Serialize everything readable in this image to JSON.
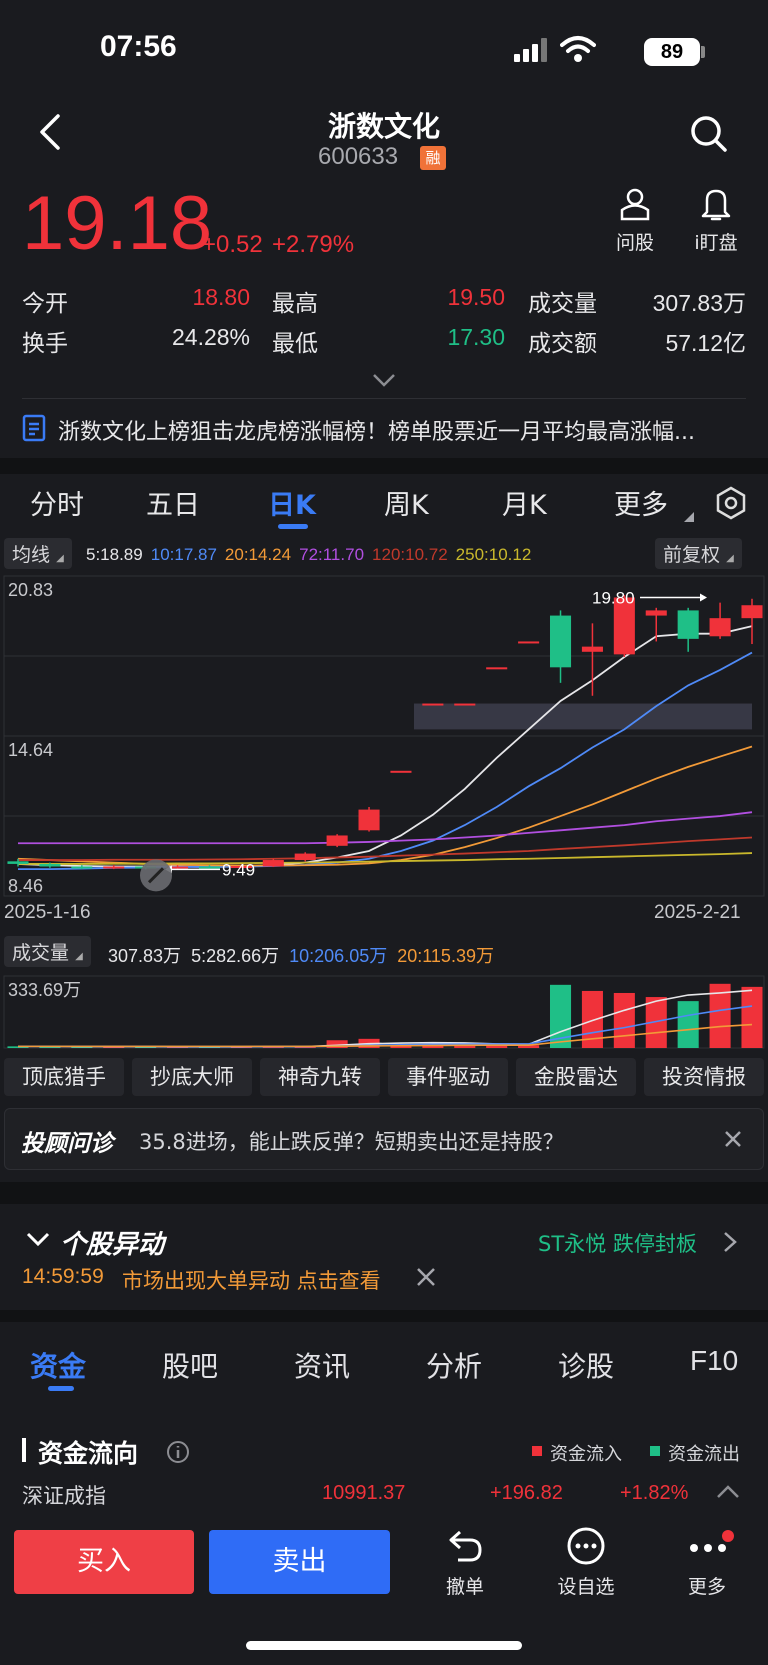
{
  "status_bar": {
    "time": "07:56",
    "battery": "89"
  },
  "header": {
    "title": "浙数文化",
    "code": "600633",
    "rong_badge": "融"
  },
  "quote": {
    "price": "19.18",
    "change": "+0.52",
    "change_pct": "+2.79%",
    "ask_label": "问股",
    "watch_label": "i盯盘",
    "open_label": "今开",
    "open": "18.80",
    "high_label": "最高",
    "high": "19.50",
    "volume_label": "成交量",
    "volume": "307.83万",
    "turnover_label": "换手",
    "turnover": "24.28%",
    "low_label": "最低",
    "low": "17.30",
    "amount_label": "成交额",
    "amount": "57.12亿"
  },
  "news": {
    "text": "浙数文化上榜狙击龙虎榜涨幅榜！榜单股票近一月平均最高涨幅..."
  },
  "chart_tabs": [
    "分时",
    "五日",
    "日K",
    "周K",
    "月K",
    "更多"
  ],
  "active_chart_tab": "日K",
  "ma_bar": {
    "label": "均线",
    "items": [
      {
        "text": "5:18.89",
        "color": "#e6e6e9"
      },
      {
        "text": "10:17.87",
        "color": "#4f8af7"
      },
      {
        "text": "20:14.24",
        "color": "#f29a38"
      },
      {
        "text": "72:11.70",
        "color": "#b14fe0"
      },
      {
        "text": "120:10.72",
        "color": "#c0392b"
      },
      {
        "text": "250:10.12",
        "color": "#c9b82c"
      }
    ],
    "adjust": "前复权"
  },
  "chart_data": {
    "type": "candlestick",
    "y_top_label": "20.83",
    "y_mid_label": "14.64",
    "y_bottom_label": "8.46",
    "ylim": [
      8.46,
      20.83
    ],
    "x_start": "2025-1-16",
    "x_end": "2025-2-21",
    "max_annotation": "19.80",
    "min_annotation": "9.49",
    "candles": [
      {
        "o": 9.8,
        "c": 9.7,
        "h": 9.9,
        "l": 9.6
      },
      {
        "o": 9.7,
        "c": 9.6,
        "h": 9.75,
        "l": 9.55
      },
      {
        "o": 9.6,
        "c": 9.55,
        "h": 9.65,
        "l": 9.5
      },
      {
        "o": 9.55,
        "c": 9.6,
        "h": 9.65,
        "l": 9.5
      },
      {
        "o": 9.6,
        "c": 9.55,
        "h": 9.65,
        "l": 9.49
      },
      {
        "o": 9.55,
        "c": 9.6,
        "h": 9.65,
        "l": 9.5
      },
      {
        "o": 9.6,
        "c": 9.58,
        "h": 9.65,
        "l": 9.52
      },
      {
        "o": 9.58,
        "c": 9.62,
        "h": 9.66,
        "l": 9.55
      },
      {
        "o": 9.6,
        "c": 9.85,
        "h": 9.9,
        "l": 9.58
      },
      {
        "o": 9.85,
        "c": 10.1,
        "h": 10.15,
        "l": 9.8
      },
      {
        "o": 10.4,
        "c": 10.8,
        "h": 10.85,
        "l": 10.35
      },
      {
        "o": 11.0,
        "c": 11.8,
        "h": 11.9,
        "l": 10.95
      },
      {
        "o": 13.3,
        "c": 13.3,
        "h": 13.3,
        "l": 13.3
      },
      {
        "o": 15.9,
        "c": 15.9,
        "h": 15.9,
        "l": 15.9
      },
      {
        "o": 15.9,
        "c": 15.9,
        "h": 15.9,
        "l": 15.9
      },
      {
        "o": 17.3,
        "c": 17.3,
        "h": 17.3,
        "l": 17.3
      },
      {
        "o": 18.3,
        "c": 18.3,
        "h": 18.3,
        "l": 18.3
      },
      {
        "o": 19.3,
        "c": 17.3,
        "h": 19.5,
        "l": 16.7
      },
      {
        "o": 17.9,
        "c": 18.1,
        "h": 19.0,
        "l": 16.2
      },
      {
        "o": 17.8,
        "c": 20.0,
        "h": 20.1,
        "l": 17.7
      },
      {
        "o": 19.3,
        "c": 19.5,
        "h": 19.6,
        "l": 18.3
      },
      {
        "o": 19.5,
        "c": 18.4,
        "h": 19.6,
        "l": 17.9
      },
      {
        "o": 18.5,
        "c": 19.2,
        "h": 19.8,
        "l": 18.4
      },
      {
        "o": 19.2,
        "c": 19.7,
        "h": 19.95,
        "l": 18.2
      }
    ],
    "ma_series": [
      {
        "name": "MA5",
        "color": "#e6e6e9",
        "values": [
          9.7,
          9.65,
          9.62,
          9.6,
          9.6,
          9.6,
          9.58,
          9.6,
          9.65,
          9.75,
          9.95,
          10.2,
          10.8,
          11.6,
          12.6,
          13.8,
          14.9,
          16.0,
          16.8,
          17.7,
          18.5,
          18.6,
          18.6,
          18.89
        ]
      },
      {
        "name": "MA10",
        "color": "#4f8af7",
        "values": [
          9.5,
          9.5,
          9.52,
          9.55,
          9.56,
          9.58,
          9.59,
          9.6,
          9.62,
          9.66,
          9.75,
          9.9,
          10.2,
          10.6,
          11.2,
          11.9,
          12.7,
          13.4,
          14.2,
          14.9,
          15.8,
          16.6,
          17.2,
          17.87
        ]
      },
      {
        "name": "MA20",
        "color": "#f29a38",
        "values": [
          9.9,
          9.85,
          9.8,
          9.75,
          9.7,
          9.67,
          9.65,
          9.64,
          9.64,
          9.65,
          9.67,
          9.72,
          9.85,
          10.05,
          10.35,
          10.7,
          11.1,
          11.55,
          12.0,
          12.5,
          13.0,
          13.45,
          13.85,
          14.24
        ]
      },
      {
        "name": "MA72",
        "color": "#b14fe0",
        "values": [
          10.5,
          10.5,
          10.5,
          10.5,
          10.5,
          10.5,
          10.5,
          10.5,
          10.5,
          10.5,
          10.52,
          10.55,
          10.6,
          10.65,
          10.72,
          10.8,
          10.9,
          11.0,
          11.1,
          11.2,
          11.35,
          11.45,
          11.55,
          11.7
        ]
      },
      {
        "name": "MA120",
        "color": "#c0392b",
        "values": [
          9.85,
          9.85,
          9.85,
          9.86,
          9.86,
          9.86,
          9.87,
          9.88,
          9.9,
          9.92,
          9.95,
          9.98,
          10.02,
          10.06,
          10.1,
          10.15,
          10.2,
          10.28,
          10.35,
          10.42,
          10.5,
          10.58,
          10.65,
          10.72
        ]
      },
      {
        "name": "MA250",
        "color": "#c9b82c",
        "values": [
          9.7,
          9.7,
          9.7,
          9.71,
          9.71,
          9.72,
          9.72,
          9.73,
          9.74,
          9.75,
          9.77,
          9.79,
          9.81,
          9.83,
          9.85,
          9.88,
          9.9,
          9.93,
          9.96,
          9.99,
          10.02,
          10.05,
          10.08,
          10.12
        ]
      }
    ],
    "volume": {
      "label": "成交量",
      "items": [
        {
          "text": "307.83万",
          "color": "#e6e6e9"
        },
        {
          "text": "5:282.66万",
          "color": "#e6e6e9"
        },
        {
          "text": "10:206.05万",
          "color": "#4f8af7"
        },
        {
          "text": "20:115.39万",
          "color": "#f29a38"
        }
      ],
      "max_label": "333.69万",
      "values": [
        8,
        7,
        6,
        7,
        6,
        6,
        6,
        6,
        8,
        9,
        38,
        45,
        10,
        10,
        10,
        12,
        14,
        310,
        280,
        270,
        250,
        230,
        315,
        300
      ],
      "up": [
        false,
        false,
        false,
        true,
        false,
        true,
        false,
        true,
        true,
        true,
        true,
        true,
        true,
        true,
        true,
        true,
        true,
        false,
        true,
        true,
        true,
        false,
        true,
        true
      ]
    }
  },
  "feature_buttons": [
    "顶底猎手",
    "抄底大师",
    "神奇九转",
    "事件驱动",
    "金股雷达",
    "投资情报"
  ],
  "advisor": {
    "title": "投顾问诊",
    "text": "35.8进场，能止跌反弹？短期卖出还是持股？"
  },
  "anomaly": {
    "title": "个股异动",
    "related": "ST永悦 跌停封板",
    "time": "14:59:59",
    "text": "市场出现大单异动 点击查看"
  },
  "bottom_tabs": [
    "资金",
    "股吧",
    "资讯",
    "分析",
    "诊股",
    "F10"
  ],
  "active_bottom_tab": "资金",
  "fund_flow": {
    "title": "资金流向",
    "inflow": "资金流入",
    "outflow": "资金流出",
    "index_name": "深证成指",
    "index_value": "10991.37",
    "index_change": "+196.82",
    "index_pct": "+1.82%"
  },
  "actions": {
    "buy": "买入",
    "sell": "卖出",
    "cancel": "撤单",
    "watchlist": "设自选",
    "more": "更多"
  },
  "colors": {
    "up": "#f0323a",
    "down": "#1fbf87",
    "accent": "#3a7bf5"
  }
}
